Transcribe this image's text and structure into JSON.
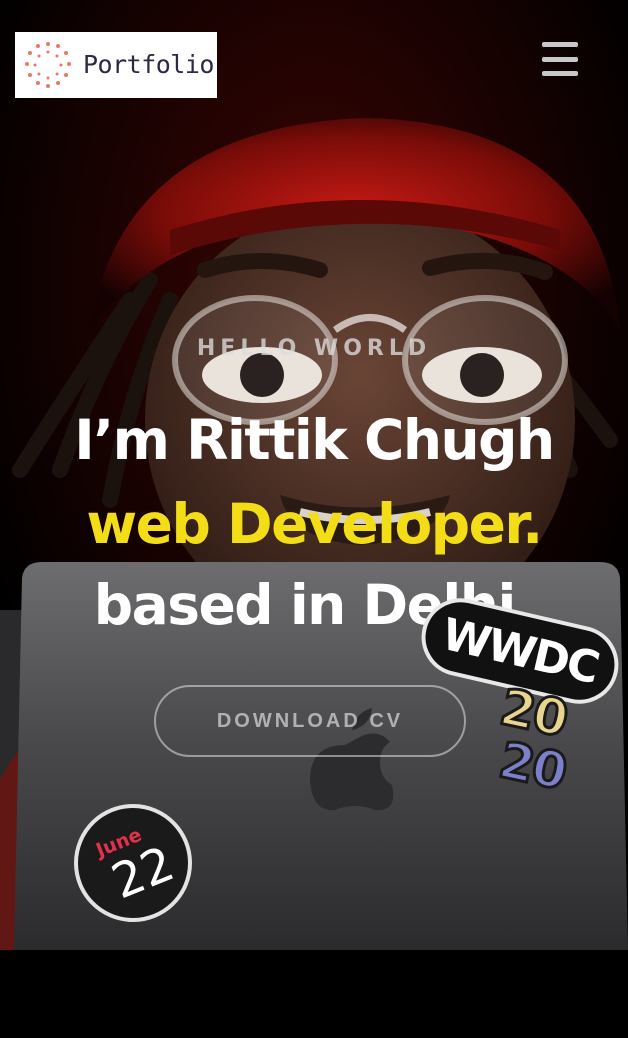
{
  "header": {
    "logo_text": "Portfolio",
    "menu_icon": "hamburger-menu-icon"
  },
  "hero": {
    "eyebrow": "HELLO WORLD",
    "line1": "I’m Rittik Chugh",
    "line2": "web Developer.",
    "line3": "based in Delhi.",
    "cta_label": "DOWNLOAD CV",
    "accent_color": "#f3dd16",
    "stickers": {
      "wwdc": "WWDC",
      "year_top": "20",
      "year_bottom": "20",
      "date_month": "June",
      "date_day": "22"
    }
  },
  "next_section": {
    "title_fragment": ""
  }
}
